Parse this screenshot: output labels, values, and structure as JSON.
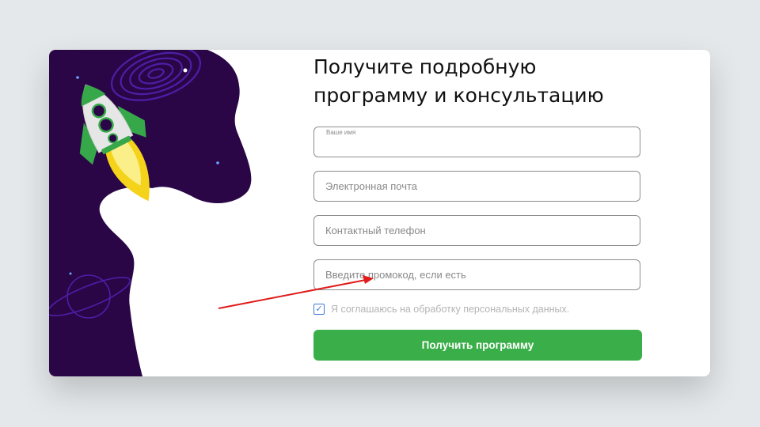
{
  "form": {
    "title_line1": "Получите подробную",
    "title_line2": "программу и консультацию",
    "name_label": "Ваше имя",
    "name_value": "",
    "email_placeholder": "Электронная почта",
    "phone_placeholder": "Контактный телефон",
    "promo_placeholder": "Введите промокод, если есть",
    "consent_checked": true,
    "consent_text": "Я соглашаюсь на обработку персональных данных.",
    "submit_label": "Получить программу"
  },
  "colors": {
    "space_purple": "#2b0647",
    "submit_green": "#3aaf49",
    "checkbox_blue": "#3a78d8",
    "annotation_red": "#e01b1b"
  },
  "icons": {
    "rocket": "rocket-illustration",
    "planet": "planet-outline",
    "galaxy": "spiral-galaxy",
    "check": "checkmark-icon"
  }
}
